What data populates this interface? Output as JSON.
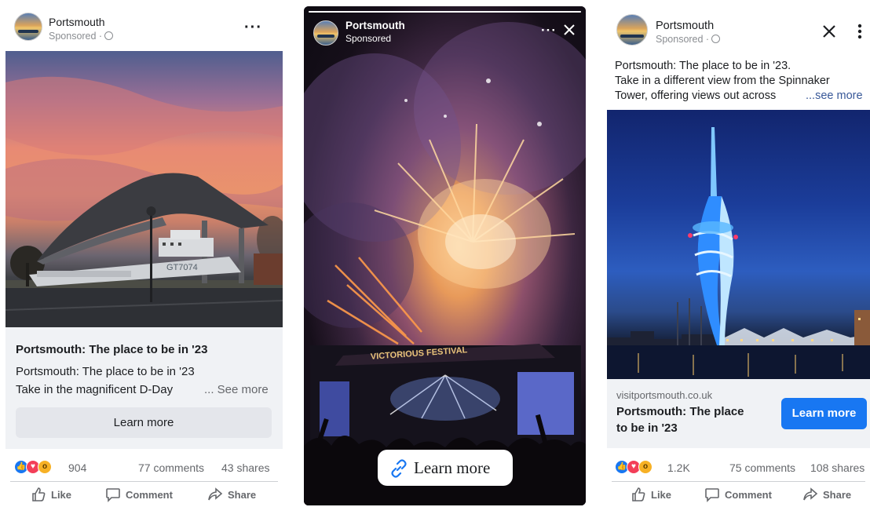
{
  "colors": {
    "facebook_blue": "#1877f2",
    "text": "#1c1e21",
    "muted": "#65676b",
    "card_bg": "#f0f2f5",
    "link": "#385898"
  },
  "ads": [
    {
      "page_name": "Portsmouth",
      "sponsored": "Sponsored ·",
      "menu_icon": "more-horizontal-icon",
      "card_title": "Portsmouth: The place to be in '23",
      "text_line1": "Portsmouth: The place to be in '23",
      "text_line2": "Take in the magnificent D-Day",
      "see_more": "... See more",
      "cta": "Learn more",
      "reaction_count": "904",
      "comments": "77 comments",
      "shares": "43 shares",
      "actions": {
        "like": "Like",
        "comment": "Comment",
        "share": "Share"
      }
    },
    {
      "page_name": "Portsmouth",
      "sponsored": "Sponsored",
      "menu_icon": "more-horizontal-icon",
      "close_icon": "close-icon",
      "stage_sign": "VICTORIOUS FESTIVAL",
      "cta": "Learn more",
      "cta_icon": "link-icon"
    },
    {
      "page_name": "Portsmouth",
      "sponsored": "Sponsored ·",
      "close_icon": "close-icon",
      "menu_icon": "more-vertical-icon",
      "desc_line1": "Portsmouth: The place to be in '23.",
      "desc_line2": "Take in a different view from the Spinnaker",
      "desc_line3": "Tower, offering views out across",
      "see_more": "...see more",
      "domain": "visitportsmouth.co.uk",
      "link_title": "Portsmouth: The place to be in '23",
      "cta": "Learn more",
      "reaction_count": "1.2K",
      "comments": "75 comments",
      "shares": "108 shares",
      "actions": {
        "like": "Like",
        "comment": "Comment",
        "share": "Share"
      }
    }
  ],
  "ad1_photo": {
    "ship_label": "GT7074"
  }
}
